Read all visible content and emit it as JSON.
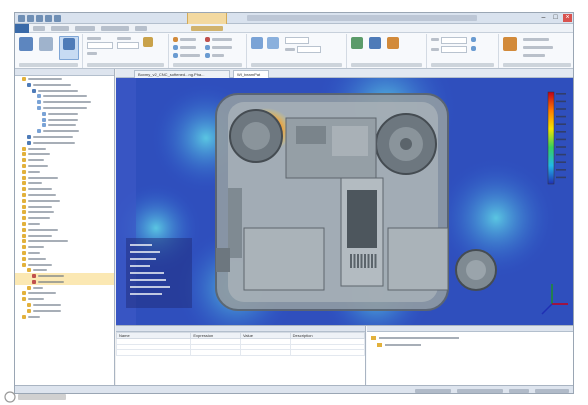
{
  "doc_tabs": [
    {
      "label": "Boxmy_v2_CNC_softened...ng.Pha...",
      "active": false
    },
    {
      "label": "WI_beamPat",
      "active": true
    }
  ],
  "parameter_table": {
    "columns": [
      "Name",
      "Expression",
      "Value",
      "Description"
    ]
  },
  "colors": {
    "accent": "#3a6aa8",
    "contextual_tab": "#f3d9a0",
    "selection": "#fbe8b3",
    "close_button": "#d9534f"
  },
  "icons": [
    "close-icon",
    "maximize-icon",
    "minimize-icon",
    "folder-icon",
    "axis-triad-icon"
  ]
}
